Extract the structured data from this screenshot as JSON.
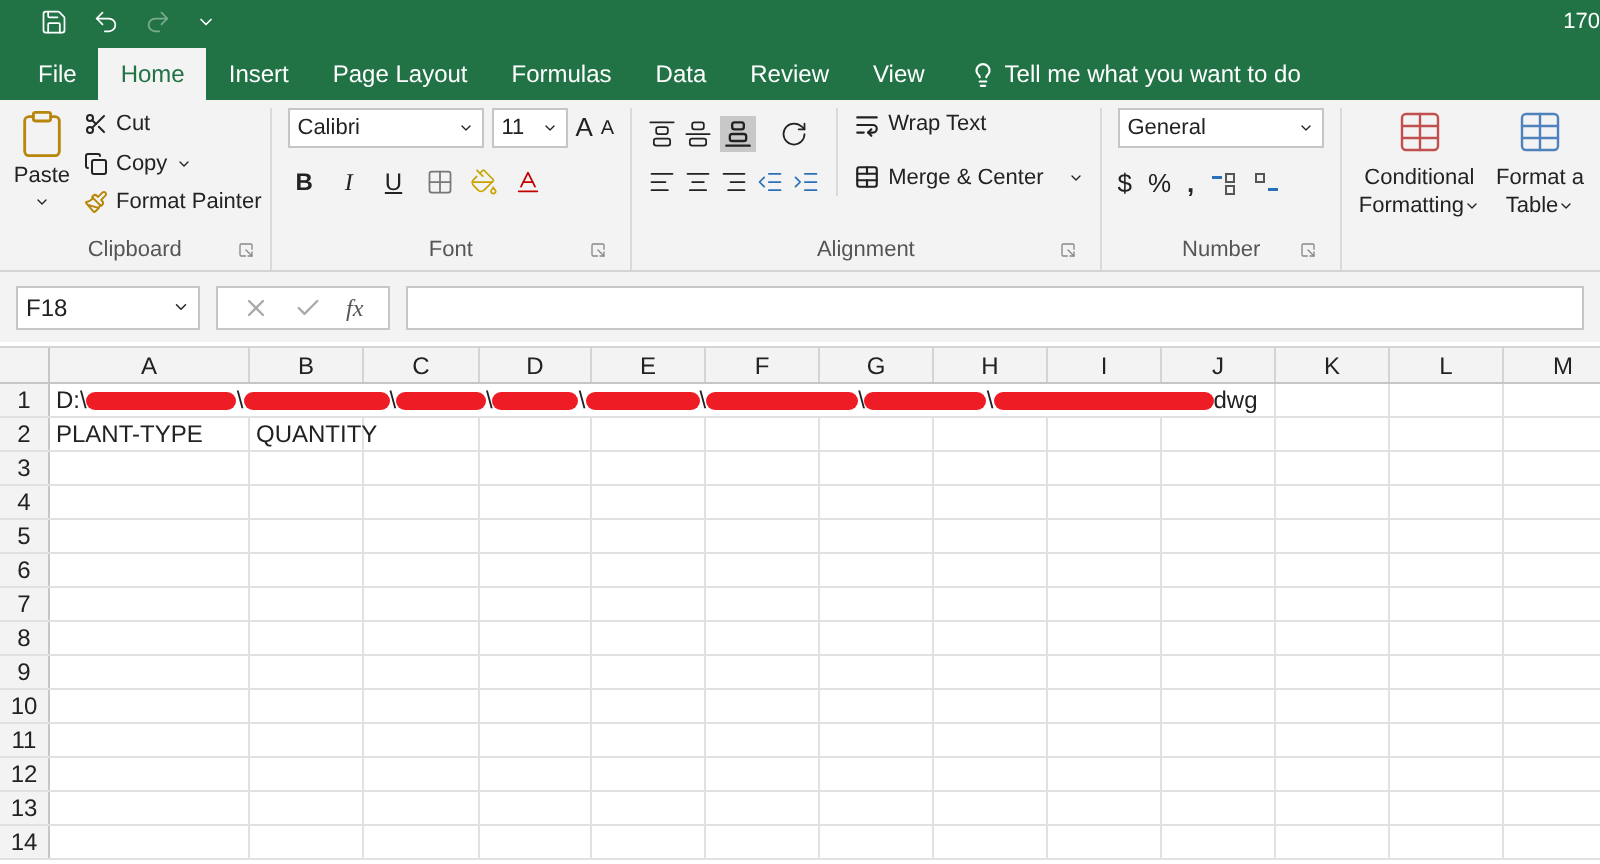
{
  "title_bar": {
    "title": "170"
  },
  "tabs": [
    {
      "label": "File",
      "selected": false
    },
    {
      "label": "Home",
      "selected": true
    },
    {
      "label": "Insert",
      "selected": false
    },
    {
      "label": "Page Layout",
      "selected": false
    },
    {
      "label": "Formulas",
      "selected": false
    },
    {
      "label": "Data",
      "selected": false
    },
    {
      "label": "Review",
      "selected": false
    },
    {
      "label": "View",
      "selected": false
    }
  ],
  "tell_me": {
    "placeholder": "Tell me what you want to do"
  },
  "ribbon": {
    "clipboard": {
      "paste": "Paste",
      "cut": "Cut",
      "copy": "Copy",
      "format_painter": "Format Painter",
      "label": "Clipboard"
    },
    "font": {
      "name": "Calibri",
      "size": "11",
      "grow": "A",
      "shrink": "A",
      "bold": "B",
      "italic": "I",
      "underline": "U",
      "label": "Font"
    },
    "alignment": {
      "wrap_text": "Wrap Text",
      "merge": "Merge & Center",
      "label": "Alignment"
    },
    "number": {
      "format": "General",
      "currency": "$",
      "percent": "%",
      "comma": ",",
      "label": "Number"
    },
    "styles": [
      {
        "line1": "Conditional",
        "line2": "Formatting"
      },
      {
        "line1": "Format a",
        "line2": "Table"
      }
    ]
  },
  "formula_bar": {
    "name_box": "F18",
    "fx": "fx"
  },
  "columns": [
    "A",
    "B",
    "C",
    "D",
    "E",
    "F",
    "G",
    "H",
    "I",
    "J",
    "K",
    "L",
    "M"
  ],
  "rows": [
    {
      "number": "1",
      "segments": [
        {
          "kind": "text",
          "text": "D:\\"
        },
        {
          "kind": "redacted"
        },
        {
          "kind": "text",
          "text": "\\"
        },
        {
          "kind": "redacted"
        },
        {
          "kind": "text",
          "text": "\\"
        },
        {
          "kind": "redacted"
        },
        {
          "kind": "text",
          "text": "\\"
        },
        {
          "kind": "redacted"
        },
        {
          "kind": "text",
          "text": "\\"
        },
        {
          "kind": "redacted"
        },
        {
          "kind": "text",
          "text": "\\"
        },
        {
          "kind": "redacted"
        },
        {
          "kind": "text",
          "text": "\\"
        },
        {
          "kind": "redacted"
        },
        {
          "kind": "text",
          "text": "\\"
        },
        {
          "kind": "redacted"
        },
        {
          "kind": "text",
          "text": "dwg"
        }
      ]
    },
    {
      "number": "2",
      "cells": [
        "PLANT-TYPE",
        "QUANTITY"
      ]
    },
    {
      "number": "3"
    },
    {
      "number": "4"
    },
    {
      "number": "5"
    },
    {
      "number": "6"
    },
    {
      "number": "7"
    },
    {
      "number": "8"
    },
    {
      "number": "9"
    },
    {
      "number": "10"
    },
    {
      "number": "11"
    },
    {
      "number": "12"
    },
    {
      "number": "13"
    },
    {
      "number": "14"
    }
  ]
}
